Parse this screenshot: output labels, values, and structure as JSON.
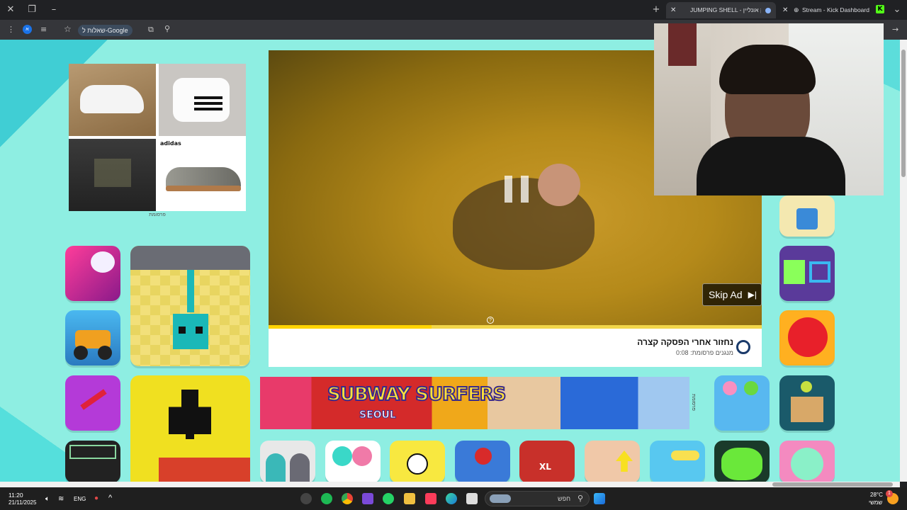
{
  "tabs": [
    {
      "title": "JUMPING SHELL - משחק אונליין",
      "active": true
    },
    {
      "title": "Stream - Kick Dashboard",
      "active": false
    }
  ],
  "toolbar": {
    "ask_google_label": "שאלות ל-Google"
  },
  "ad_side": {
    "label": "פרסומת",
    "brand": "adidas"
  },
  "video_ad": {
    "skip_label": "Skip Ad",
    "title": "נחזור אחרי הפסקה קצרה",
    "subtitle": "מנגנים פרסומת: 0:08",
    "progress": 0.33
  },
  "banner": {
    "title": "SUBWAY SURFERS",
    "subtitle": "SEOUL",
    "side_label": "פרסומת"
  },
  "taskbar": {
    "time": "11:20",
    "date": "21/11/2025",
    "lang": "ENG",
    "search_placeholder": "חפש",
    "temp": "28°C",
    "weather": "שמשי",
    "xl_label": "XL",
    "notification_count": "1"
  },
  "colors": {
    "page_bg": "#8eeee2",
    "accent": "#ffd400"
  }
}
